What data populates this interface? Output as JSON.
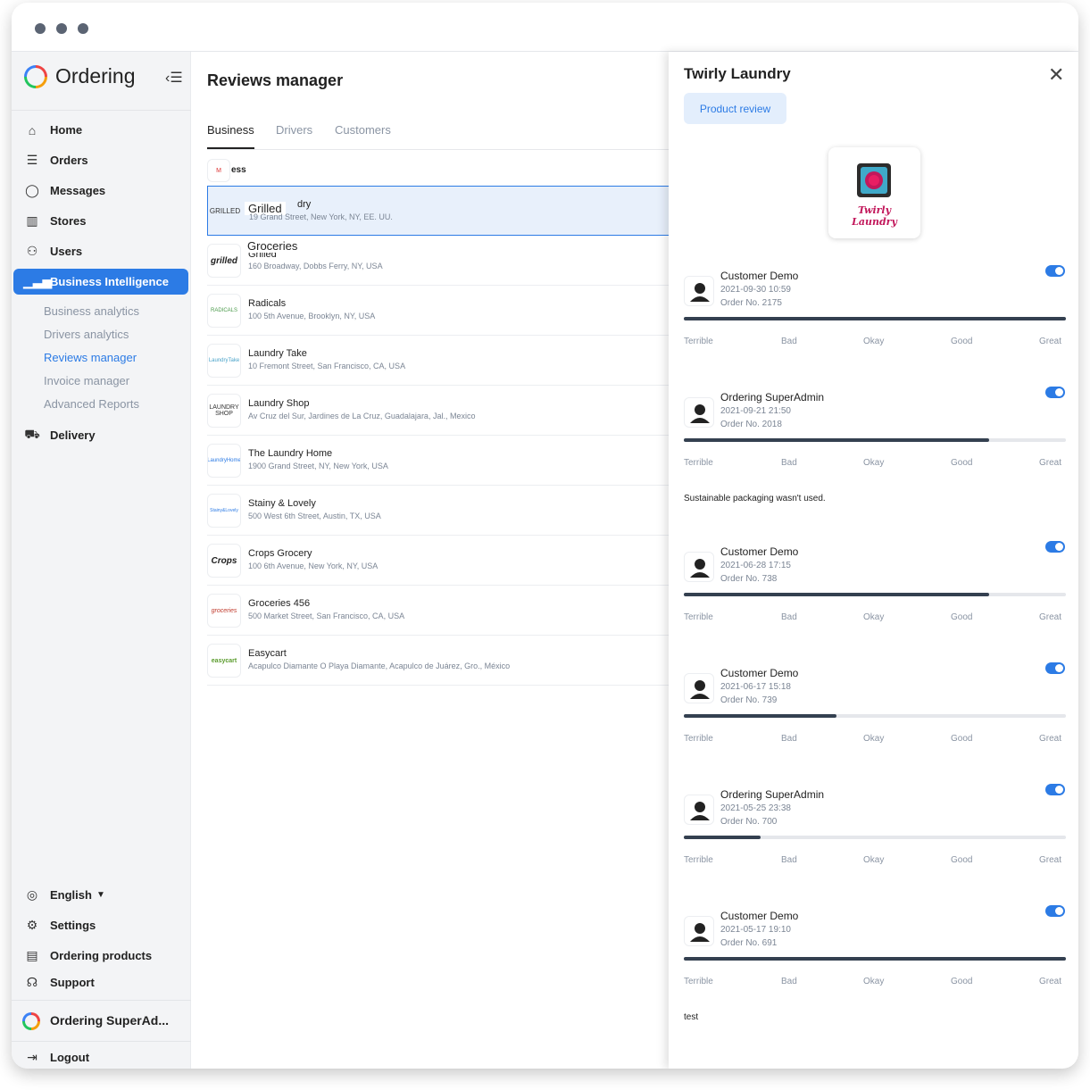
{
  "app": {
    "brand": "Ordering"
  },
  "sidebar": {
    "nav": [
      {
        "label": "Home",
        "icon": "home-icon"
      },
      {
        "label": "Orders",
        "icon": "list-icon"
      },
      {
        "label": "Messages",
        "icon": "chat-icon"
      },
      {
        "label": "Stores",
        "icon": "store-icon"
      },
      {
        "label": "Users",
        "icon": "users-icon"
      },
      {
        "label": "Business Intelligence",
        "icon": "chart-icon"
      }
    ],
    "sub": [
      "Business analytics",
      "Drivers analytics",
      "Reviews manager",
      "Invoice manager",
      "Advanced Reports"
    ],
    "delivery": "Delivery",
    "language": "English",
    "settings": "Settings",
    "ordering_products": "Ordering products",
    "support": "Support",
    "user": "Ordering SuperAd...",
    "logout": "Logout"
  },
  "main": {
    "title": "Reviews manager",
    "tabs": [
      "Business",
      "Drivers",
      "Customers"
    ],
    "header_label": "ess",
    "businesses": [
      {
        "name": "dry",
        "overlay": "Grilled",
        "address": "19 Grand Street, New York, NY, EE. UU.",
        "logo": "GRILLED"
      },
      {
        "name": "Grilled",
        "overlay": "Groceries",
        "address": "160 Broadway, Dobbs Ferry, NY, USA",
        "logo": "grilled"
      },
      {
        "name": "Radicals",
        "address": "100 5th Avenue, Brooklyn, NY, USA",
        "logo": "RADICALS"
      },
      {
        "name": "Laundry Take",
        "address": "10 Fremont Street, San Francisco, CA, USA",
        "logo": "LaundryTake"
      },
      {
        "name": "Laundry Shop",
        "address": "Av Cruz del Sur, Jardines de La Cruz, Guadalajara, Jal., Mexico",
        "logo": "LAUNDRY SHOP"
      },
      {
        "name": "The Laundry Home",
        "address": "1900 Grand Street, NY, New York, USA",
        "logo": "LaundryHome"
      },
      {
        "name": "Stainy & Lovely",
        "address": "500 West 6th Street, Austin, TX, USA",
        "logo": "Stainy&Lovely"
      },
      {
        "name": "Crops Grocery",
        "address": "100 6th Avenue, New York, NY, USA",
        "logo": "Crops"
      },
      {
        "name": "Groceries 456",
        "address": "500 Market Street, San Francisco, CA, USA",
        "logo": "groceries"
      },
      {
        "name": "Easycart",
        "address": "Acapulco Diamante O Playa Diamante, Acapulco de Juárez, Gro., México",
        "logo": "easycart"
      }
    ]
  },
  "panel": {
    "title": "Twirly Laundry",
    "product_review": "Product review",
    "logo_text": "Twirly Laundry",
    "scale": [
      "Terrible",
      "Bad",
      "Okay",
      "Good",
      "Great"
    ],
    "reviews": [
      {
        "name": "Customer Demo",
        "date": "2021-09-30 10:59",
        "order": "Order No. 2175",
        "rating": 1.0,
        "comment": ""
      },
      {
        "name": "Ordering SuperAdmin",
        "date": "2021-09-21 21:50",
        "order": "Order No. 2018",
        "rating": 0.8,
        "comment": "Sustainable packaging wasn't used."
      },
      {
        "name": "Customer Demo",
        "date": "2021-06-28 17:15",
        "order": "Order No. 738",
        "rating": 0.8,
        "comment": ""
      },
      {
        "name": "Customer Demo",
        "date": "2021-06-17 15:18",
        "order": "Order No. 739",
        "rating": 0.4,
        "comment": ""
      },
      {
        "name": "Ordering SuperAdmin",
        "date": "2021-05-25 23:38",
        "order": "Order No. 700",
        "rating": 0.2,
        "comment": ""
      },
      {
        "name": "Customer Demo",
        "date": "2021-05-17 19:10",
        "order": "Order No. 691",
        "rating": 1.0,
        "comment": "test"
      }
    ]
  },
  "colors": {
    "accent": "#2c7be5",
    "dark": "#344050",
    "sidebar_bg": "#f3f4f6"
  }
}
